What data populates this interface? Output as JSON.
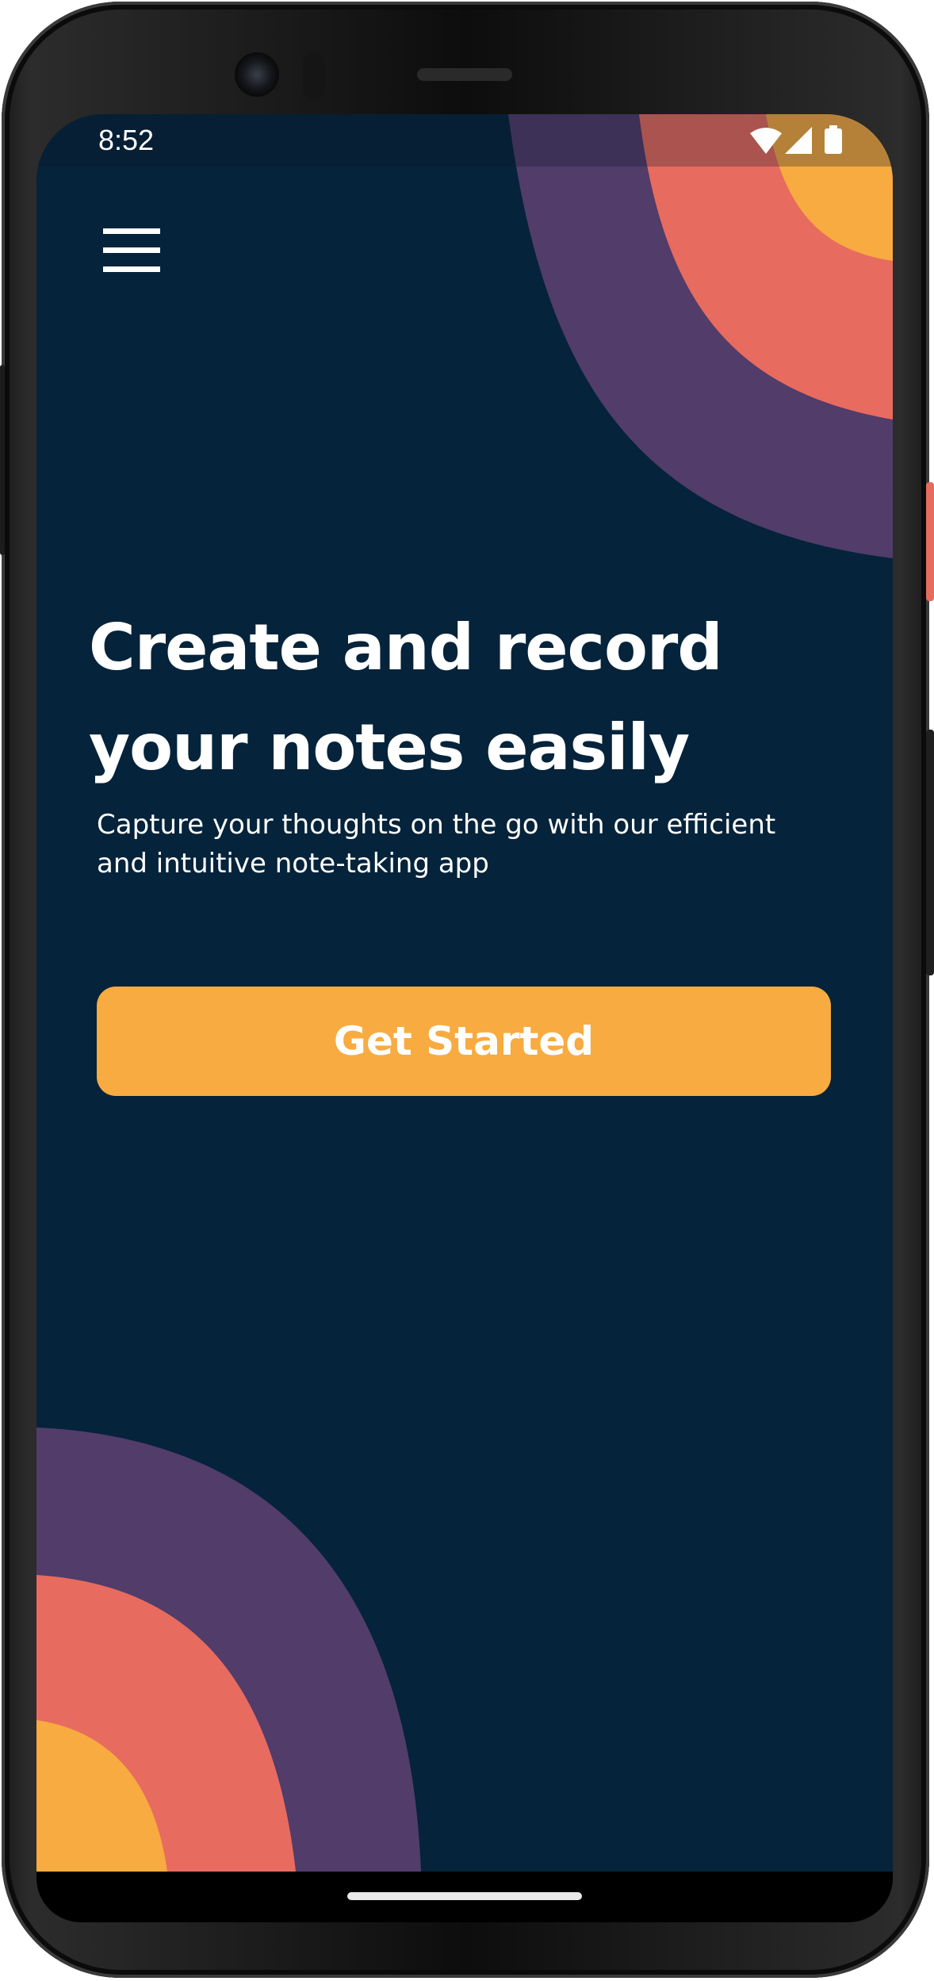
{
  "status_bar": {
    "time": "8:52",
    "icons": [
      "wifi-icon",
      "cellular-signal-icon",
      "battery-icon"
    ]
  },
  "toolbar": {
    "menu_icon": "hamburger-menu-icon"
  },
  "hero": {
    "headline_line_1": "Create and record",
    "headline_line_2": "your notes easily",
    "subtitle_line_1": "Capture your thoughts on the go with our efficient",
    "subtitle_line_2": "and intuitive note-taking app"
  },
  "cta": {
    "label": "Get Started"
  },
  "colors": {
    "background": "#05233a",
    "accent_orange": "#f7ab40",
    "accent_coral": "#e86b5f",
    "accent_purple": "#513c6a",
    "text": "#ffffff"
  }
}
